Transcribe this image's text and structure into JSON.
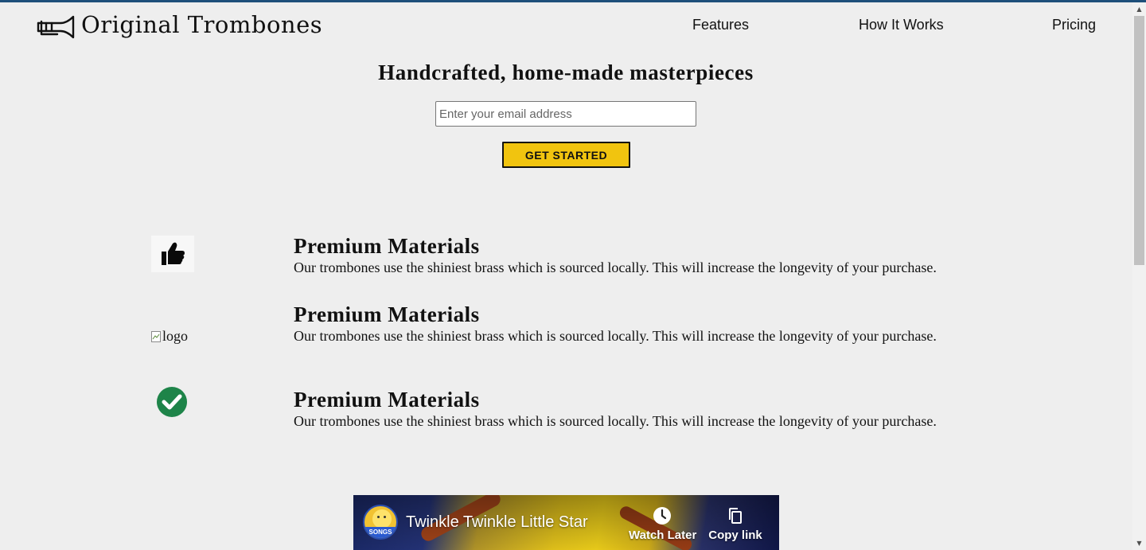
{
  "header": {
    "brand": "Original Trombones",
    "nav": [
      "Features",
      "How It Works",
      "Pricing"
    ]
  },
  "hero": {
    "title": "Handcrafted, home-made masterpieces",
    "email_placeholder": "Enter your email address",
    "cta_label": "GET STARTED"
  },
  "features": [
    {
      "icon": "thumbs-up-icon",
      "title": "Premium Materials",
      "description": "Our trombones use the shiniest brass which is sourced locally. This will increase the longevity of your purchase."
    },
    {
      "icon_alt": "logo",
      "title": "Premium Materials",
      "description": "Our trombones use the shiniest brass which is sourced locally. This will increase the longevity of your purchase."
    },
    {
      "icon": "check-circle-icon",
      "title": "Premium Materials",
      "description": "Our trombones use the shiniest brass which is sourced locally. This will increase the longevity of your purchase."
    }
  ],
  "video": {
    "channel_badge": "SONGS",
    "title": "Twinkle Twinkle Little Star",
    "watch_later_label": "Watch Later",
    "copy_link_label": "Copy link"
  },
  "colors": {
    "background": "#eeeeee",
    "accent": "#f1c40f",
    "top_border": "#1e4f7a",
    "check_green": "#1e8449"
  }
}
